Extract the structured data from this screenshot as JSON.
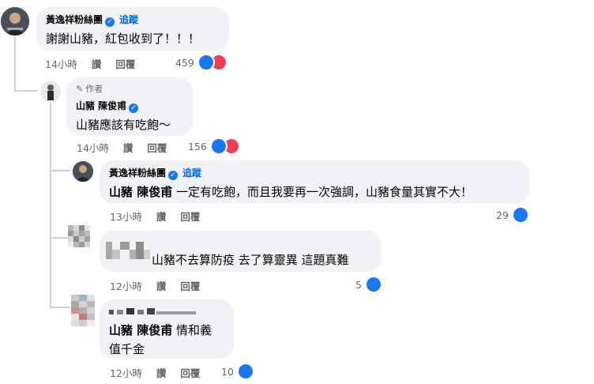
{
  "comments": [
    {
      "author": "黃逸祥粉絲團",
      "follow": "追蹤",
      "text": "謝謝山豬，紅包收到了！！！",
      "time": "14小時",
      "like": "讚",
      "reply": "回覆",
      "count": "459"
    },
    {
      "badge": "作者",
      "author": "山豬 陳俊甫",
      "text": "山豬應該有吃飽～",
      "time": "14小時",
      "like": "讚",
      "reply": "回覆",
      "count": "156"
    },
    {
      "author": "黃逸祥粉絲團",
      "follow": "追蹤",
      "mention": "山豬 陳俊甫",
      "text": " 一定有吃飽，而且我要再一次強調，山豬食量其實不大！",
      "time": "13小時",
      "like": "讚",
      "reply": "回覆",
      "count": "29"
    },
    {
      "text": "山豬不去算防疫 去了算靈異 這題真難",
      "time": "12小時",
      "like": "讚",
      "reply": "回覆",
      "count": "5"
    },
    {
      "mention": "山豬 陳俊甫",
      "text_line1": " 情和義",
      "text_line2": "值千金",
      "time": "12小時",
      "like": "讚",
      "reply": "回覆",
      "count": "10"
    }
  ],
  "icons": {
    "like": "thumbs-up-icon",
    "love": "heart-icon",
    "verified": "verified-check-icon",
    "author": "pencil-icon"
  },
  "colors": {
    "link": "#0064d1",
    "like": "#1877f2",
    "love": "#f33e58",
    "bubble": "#f0f2f5"
  }
}
